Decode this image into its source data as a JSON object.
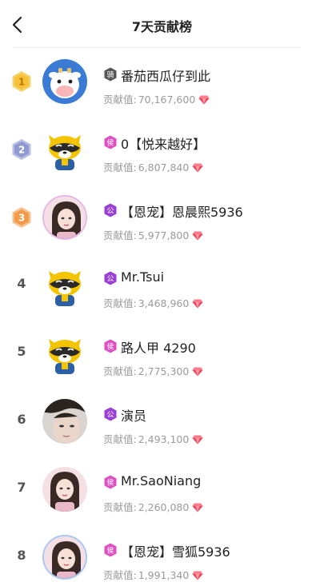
{
  "header": {
    "title": "7天贡献榜",
    "back_icon": "chevron-left-icon"
  },
  "contribution_label": "贡献值:",
  "rows": [
    {
      "rank": "1",
      "rank_style": "medal-gold",
      "tag": "骑",
      "tag_color": "#555555",
      "name": "番茄西瓜仔到此",
      "value": "70,167,600",
      "avatar": "cow"
    },
    {
      "rank": "2",
      "rank_style": "medal-silver",
      "tag": "侯",
      "tag_color": "#e04fc1",
      "name": "0【悦来越好】",
      "value": "6,807,840",
      "avatar": "raccoon"
    },
    {
      "rank": "3",
      "rank_style": "medal-bronze",
      "tag": "公",
      "tag_color": "#9a3fd6",
      "name": "【恩宠】恩晨熙5936",
      "value": "5,977,800",
      "avatar": "girl-pink"
    },
    {
      "rank": "4",
      "rank_style": "plain",
      "tag": "公",
      "tag_color": "#9a3fd6",
      "name": "Mr.Tsui",
      "value": "3,468,960",
      "avatar": "raccoon"
    },
    {
      "rank": "5",
      "rank_style": "plain",
      "tag": "侯",
      "tag_color": "#e04fc1",
      "name": "路人甲 4290",
      "value": "2,775,300",
      "avatar": "raccoon"
    },
    {
      "rank": "6",
      "rank_style": "plain",
      "tag": "公",
      "tag_color": "#9a3fd6",
      "name": "演员",
      "value": "2,493,100",
      "avatar": "face"
    },
    {
      "rank": "7",
      "rank_style": "plain",
      "tag": "侯",
      "tag_color": "#e04fc1",
      "name": "Mr.SaoNiang",
      "value": "2,260,080",
      "avatar": "girl"
    },
    {
      "rank": "8",
      "rank_style": "plain",
      "tag": "侯",
      "tag_color": "#e04fc1",
      "name": "【恩宠】雪狐5936",
      "value": "1,991,340",
      "avatar": "girl-blue"
    }
  ]
}
